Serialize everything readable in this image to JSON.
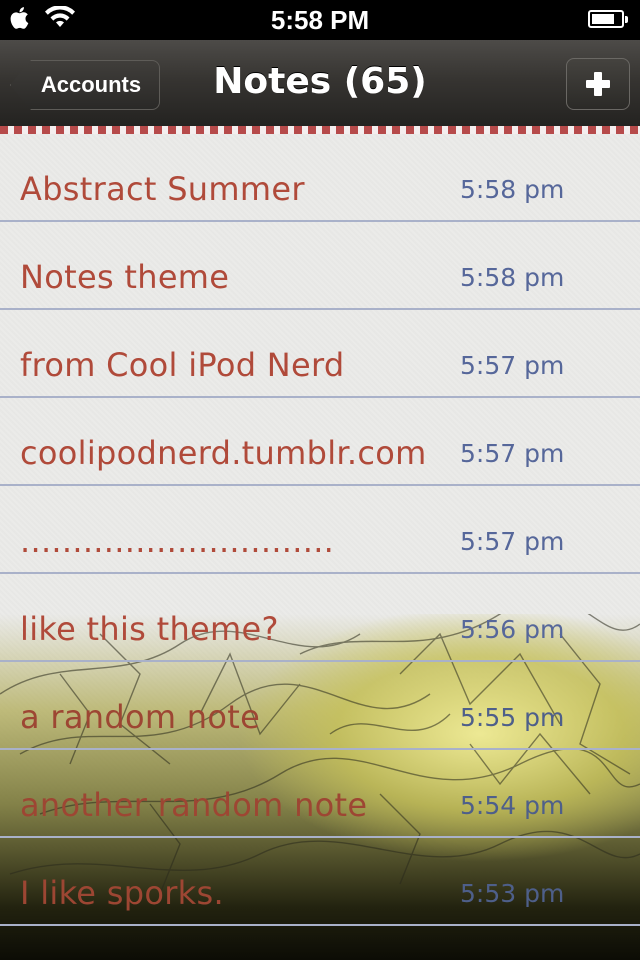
{
  "status_bar": {
    "time": "5:58 PM",
    "carrier_icon": "apple-icon",
    "signal_icon": "wifi-icon",
    "battery_icon": "battery-icon",
    "battery_level": 0.8
  },
  "nav": {
    "back_label": "Accounts",
    "title": "Notes (65)",
    "add_icon": "plus-icon"
  },
  "notes": [
    {
      "title": "Abstract Summer",
      "time": "5:58 pm"
    },
    {
      "title": "Notes theme",
      "time": "5:58 pm"
    },
    {
      "title": "from Cool iPod Nerd",
      "time": "5:57 pm"
    },
    {
      "title": "coolipodnerd.tumblr.com",
      "time": "5:57 pm"
    },
    {
      "title": "..............................",
      "time": "5:57 pm"
    },
    {
      "title": "like this theme?",
      "time": "5:56 pm"
    },
    {
      "title": "a random note",
      "time": "5:55 pm"
    },
    {
      "title": "another random note",
      "time": "5:54 pm"
    },
    {
      "title": "I like sporks.",
      "time": "5:53 pm"
    }
  ],
  "colors": {
    "note_title": "#b04a3a",
    "note_time": "#56679a",
    "row_divider": "#a9b1c9",
    "nav_trim": "#b64a4a"
  }
}
